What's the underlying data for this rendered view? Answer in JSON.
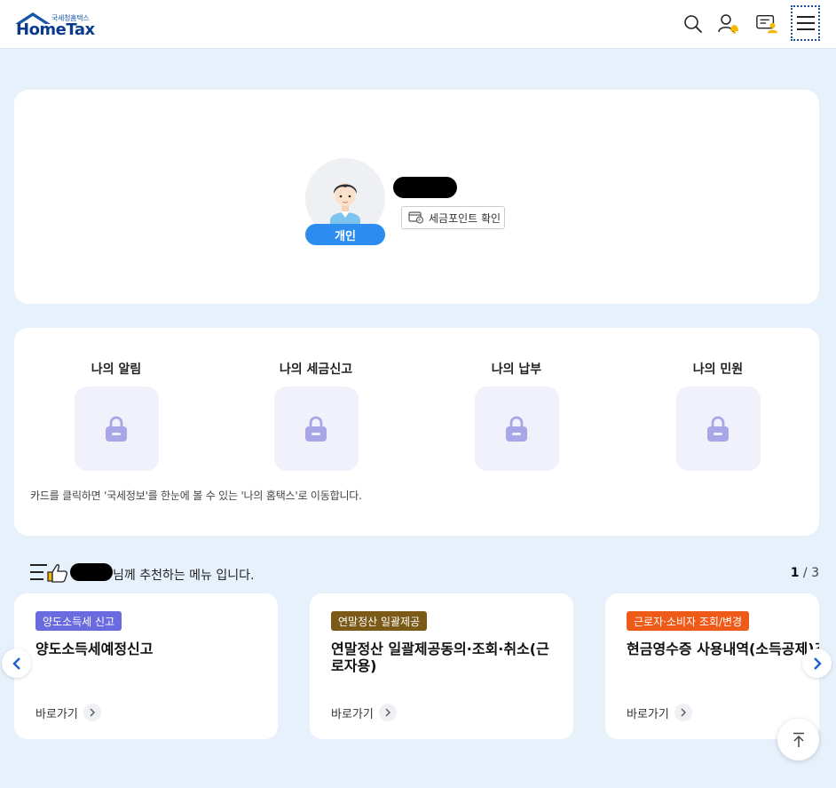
{
  "header": {
    "logo_sub": "국세청홈택스",
    "logo_main": "HomeTax",
    "icons": [
      "search-icon",
      "user-alert-icon",
      "consult-icon",
      "hamburger-menu-icon"
    ]
  },
  "profile": {
    "type_badge": "개인",
    "tax_point_button": "세금포인트 확인"
  },
  "my_section": {
    "items": [
      {
        "title": "나의 알림",
        "icon": "lock-icon"
      },
      {
        "title": "나의 세금신고",
        "icon": "lock-icon"
      },
      {
        "title": "나의 납부",
        "icon": "lock-icon"
      },
      {
        "title": "나의 민원",
        "icon": "lock-icon"
      }
    ],
    "note": "카드를 클릭하면 '국세정보'를 한눈에 볼 수 있는 '나의 홈택스'로 이동합니다."
  },
  "recommend": {
    "suffix": "님께 추천하는 메뉴 입니다.",
    "page_current": "1",
    "page_sep": " / ",
    "page_total": "3",
    "cards": [
      {
        "tag": "양도소득세 신고",
        "tag_color": "#6b6be0",
        "title": "양도소득세예정신고",
        "link": "바로가기"
      },
      {
        "tag": "연말정산 일괄제공",
        "tag_color": "#7a5a16",
        "title": "연말정산 일괄제공동의·조회·취소(근로자용)",
        "link": "바로가기"
      },
      {
        "tag": "근로자·소비자 조회/변경",
        "tag_color": "#ee5a18",
        "title": "현금영수증 사용내역(소득공제)조",
        "link": "바로가기"
      }
    ]
  },
  "colors": {
    "background": "#e7f1fb",
    "badge_blue": "#2d8cf0",
    "lock_purple": "#a8a6e6"
  }
}
